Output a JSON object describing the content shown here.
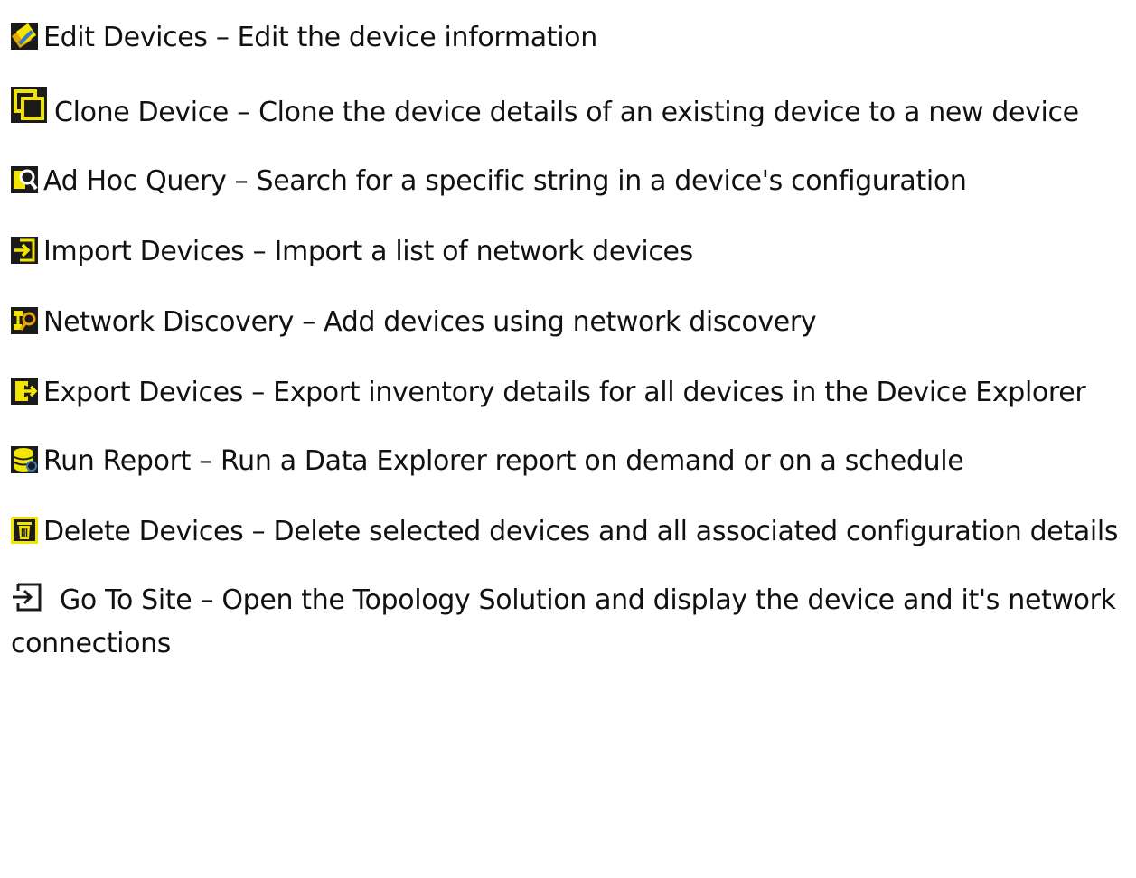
{
  "items": [
    {
      "icon": "edit-devices-icon",
      "text": "Edit Devices – Edit the device information"
    },
    {
      "icon": "clone-device-icon",
      "text": "Clone Device – Clone the device details of an existing device to a new device"
    },
    {
      "icon": "ad-hoc-query-icon",
      "text": "Ad Hoc Query – Search for a specific string in a device's configuration"
    },
    {
      "icon": "import-devices-icon",
      "text": "Import Devices – Import a list of network devices"
    },
    {
      "icon": "network-discovery-icon",
      "text": "Network Discovery – Add devices using network discovery"
    },
    {
      "icon": "export-devices-icon",
      "text": "Export Devices – Export inventory details for all devices in the Device Explorer"
    },
    {
      "icon": "run-report-icon",
      "text": "Run Report – Run a Data Explorer report on demand or on a schedule"
    },
    {
      "icon": "delete-devices-icon",
      "text": "Delete Devices – Delete selected devices and all associated configuration details"
    },
    {
      "icon": "go-to-site-icon",
      "text": "Go To Site – Open the Topology Solution and display the device and it's network connections"
    }
  ],
  "colors": {
    "icon_dark": "#1b1b1b",
    "icon_yellow": "#f2e600",
    "icon_orange": "#e8a600",
    "icon_blue": "#3a78c8",
    "text": "#111111"
  }
}
